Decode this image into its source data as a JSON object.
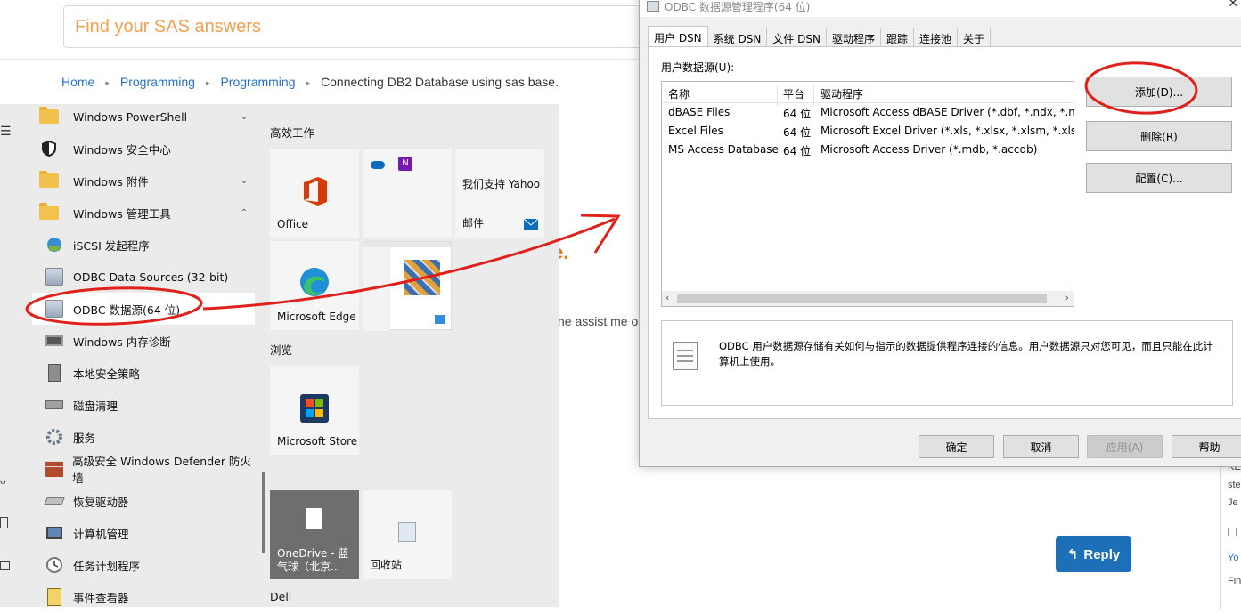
{
  "sas": {
    "search_placeholder": "Find your SAS answers",
    "breadcrumb": [
      "Home",
      "Programming",
      "Programming",
      "Connecting DB2 Database using sas base."
    ],
    "title_fragment": "e.",
    "text_fragment": "ne assist me o",
    "reply_label": "Reply",
    "side_lines": [
      "KE",
      "ste",
      "Je",
      "Yo",
      "Fin"
    ]
  },
  "start_menu": {
    "apps": [
      {
        "label": "Windows PowerShell",
        "icon": "folder-icon",
        "chevron": "down"
      },
      {
        "label": "Windows 安全中心",
        "icon": "shield-icon",
        "chevron": ""
      },
      {
        "label": "Windows 附件",
        "icon": "folder-icon",
        "chevron": "down"
      },
      {
        "label": "Windows 管理工具",
        "icon": "folder-icon",
        "chevron": "up"
      },
      {
        "label": "iSCSI 发起程序",
        "icon": "iscsi-icon",
        "chevron": ""
      },
      {
        "label": "ODBC Data Sources (32-bit)",
        "icon": "odbc-icon",
        "chevron": ""
      },
      {
        "label": "ODBC 数据源(64 位)",
        "icon": "odbc-icon",
        "chevron": ""
      },
      {
        "label": "Windows 内存诊断",
        "icon": "memory-icon",
        "chevron": ""
      },
      {
        "label": "本地安全策略",
        "icon": "security-policy-icon",
        "chevron": ""
      },
      {
        "label": "磁盘清理",
        "icon": "disk-cleanup-icon",
        "chevron": ""
      },
      {
        "label": "服务",
        "icon": "services-icon",
        "chevron": ""
      },
      {
        "label": "高级安全 Windows Defender 防火墙",
        "icon": "firewall-icon",
        "chevron": ""
      },
      {
        "label": "恢复驱动器",
        "icon": "recovery-drive-icon",
        "chevron": ""
      },
      {
        "label": "计算机管理",
        "icon": "computer-management-icon",
        "chevron": ""
      },
      {
        "label": "任务计划程序",
        "icon": "clock-icon",
        "chevron": ""
      },
      {
        "label": "事件查看器",
        "icon": "event-viewer-icon",
        "chevron": ""
      }
    ],
    "groups": [
      "高效工作",
      "浏览",
      "Dell"
    ],
    "tiles": {
      "office": "Office",
      "yahoo_top": "我们支持 Yahoo",
      "mail": "邮件",
      "edge": "Microsoft Edge",
      "store": "Microsoft Store",
      "onedrive": "OneDrive - 蓝气球（北京...",
      "recycle": "回收站"
    }
  },
  "odbc": {
    "title": "ODBC 数据源管理程序(64 位)",
    "tabs": [
      "用户 DSN",
      "系统 DSN",
      "文件 DSN",
      "驱动程序",
      "跟踪",
      "连接池",
      "关于"
    ],
    "user_ds_label": "用户数据源(U):",
    "columns": [
      "名称",
      "平台",
      "驱动程序"
    ],
    "rows": [
      [
        "dBASE Files",
        "64 位",
        "Microsoft Access dBASE Driver (*.dbf, *.ndx, *.mc"
      ],
      [
        "Excel Files",
        "64 位",
        "Microsoft Excel Driver (*.xls, *.xlsx, *.xlsm, *.xlsb)"
      ],
      [
        "MS Access Database",
        "64 位",
        "Microsoft Access Driver (*.mdb, *.accdb)"
      ]
    ],
    "side_buttons": {
      "add": "添加(D)...",
      "remove": "删除(R)",
      "configure": "配置(C)..."
    },
    "info": "ODBC 用户数据源存储有关如何与指示的数据提供程序连接的信息。用户数据源只对您可见，而且只能在此计算机上使用。",
    "bottom_buttons": {
      "ok": "确定",
      "cancel": "取消",
      "apply": "应用(A)",
      "help": "帮助"
    }
  },
  "colors": {
    "annotation": "#e0201a",
    "link": "#2671c4",
    "reply": "#1d6fb8",
    "sas_orange": "#f0a050"
  }
}
